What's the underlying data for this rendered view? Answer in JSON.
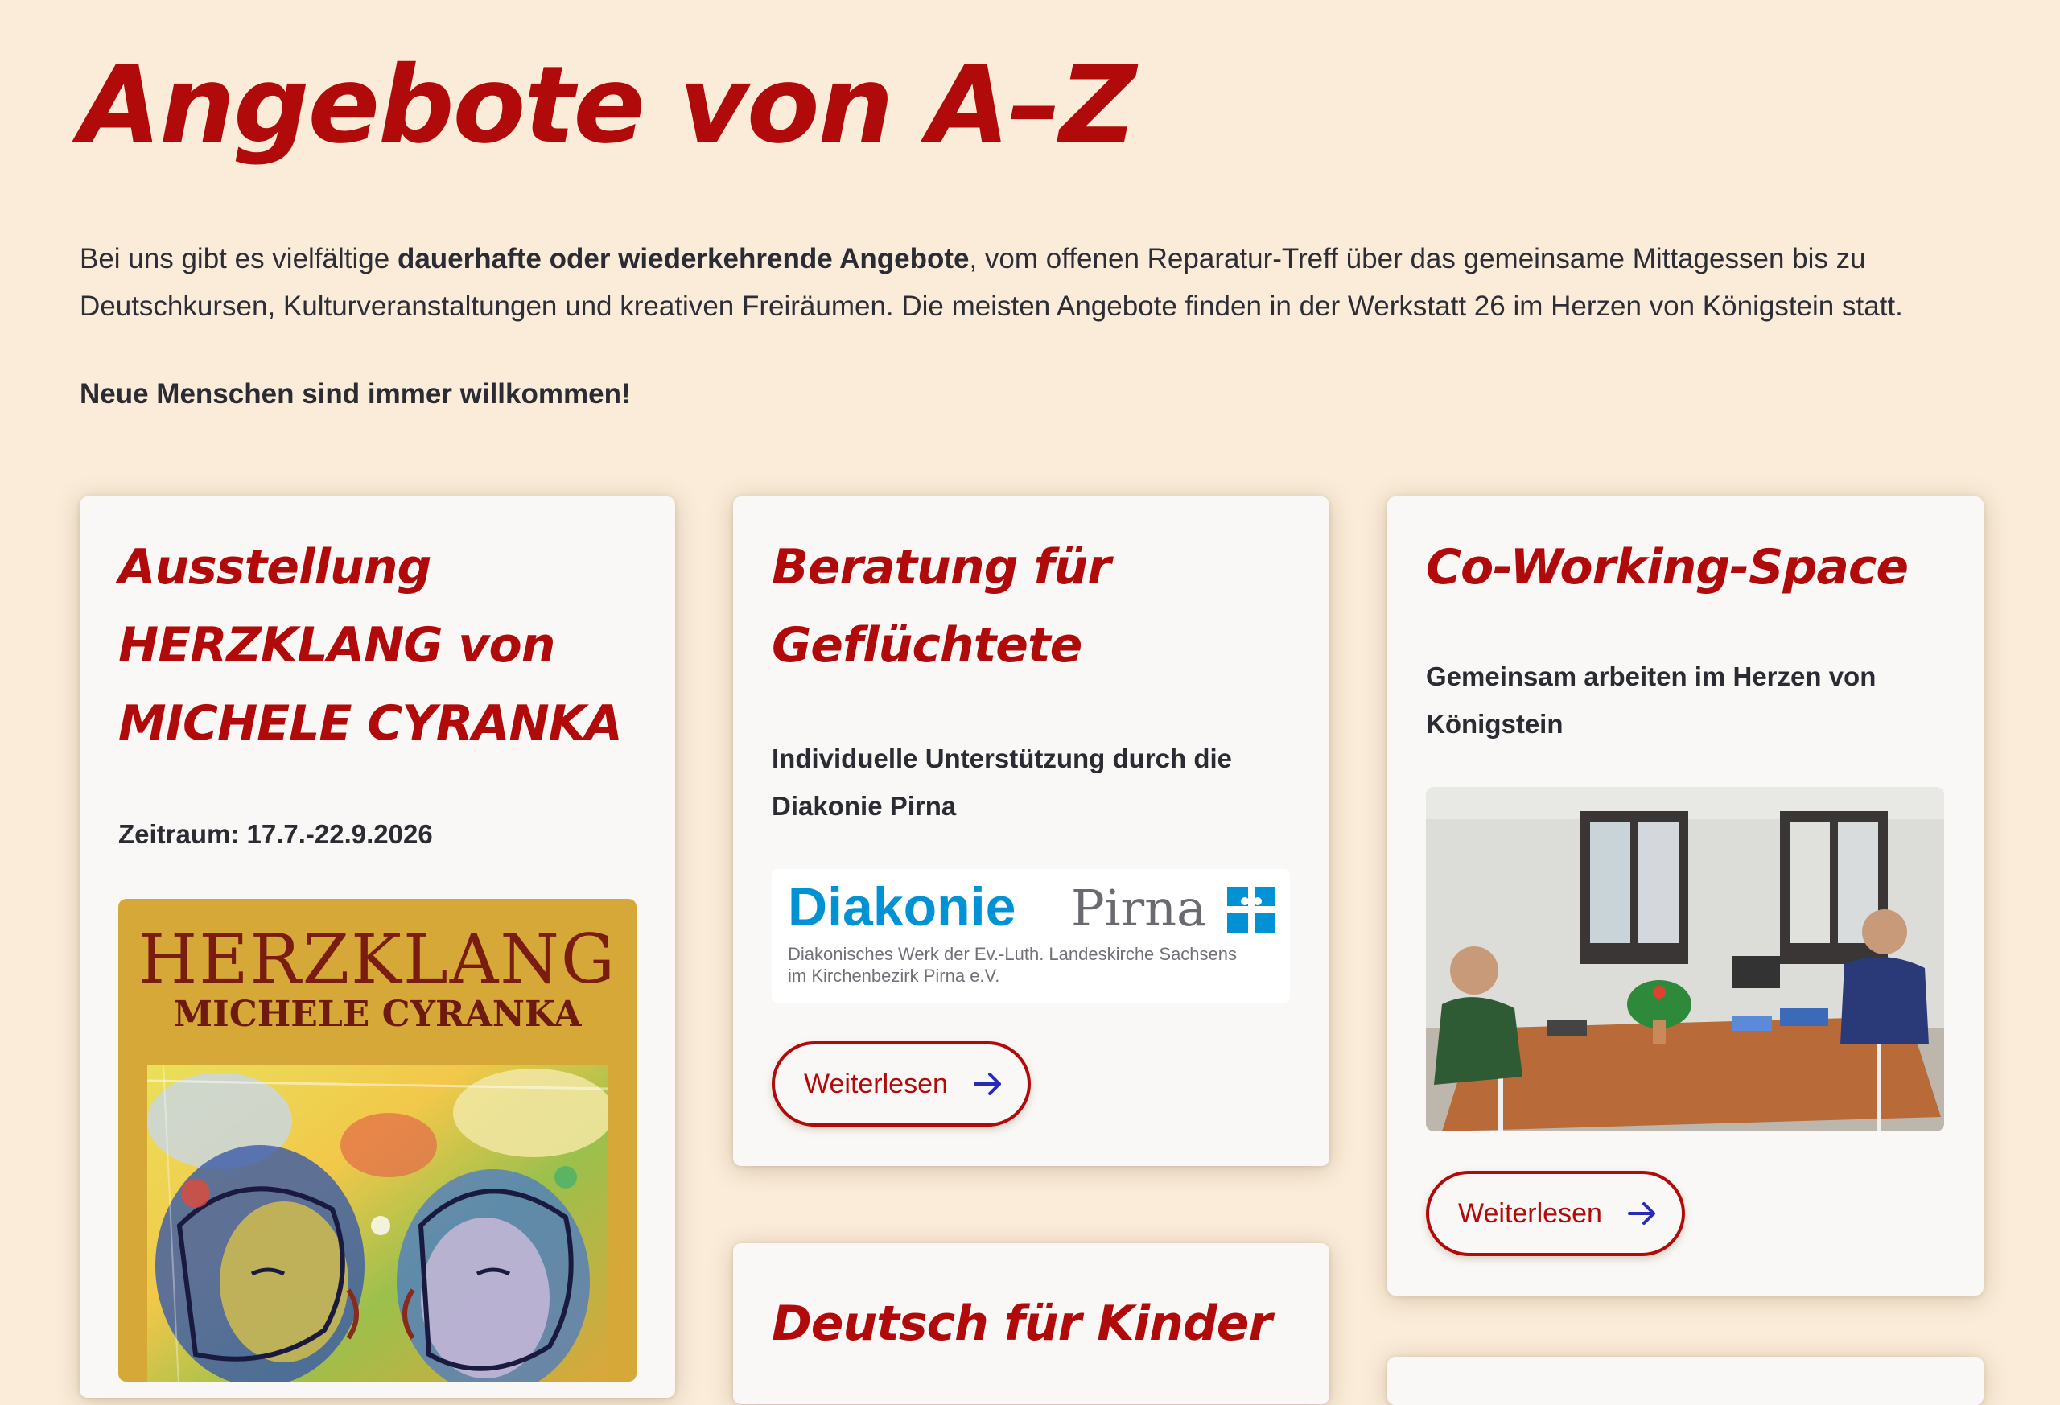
{
  "page": {
    "title": "Angebote von A–Z",
    "intro_part1": "Bei uns gibt es vielfältige ",
    "intro_bold": "dauerhafte oder wiederkehrende Angebote",
    "intro_part2": ", vom offenen Reparatur-Treff über das gemeinsame Mittagessen bis zu Deutschkursen, Kulturveranstaltungen und kreativen Freiräumen. Die meisten Angebote finden in der Werkstatt 26 im Herzen von Königstein statt.",
    "welcome": "Neue Menschen sind immer willkommen!"
  },
  "cards": [
    {
      "title": "Ausstellung HERZKLANG von MICHELE CYRANKA",
      "text": "Zeitraum: 17.7.-22.9.2026",
      "poster": {
        "title": "HERZKLANG",
        "subtitle": "MICHELE CYRANKA"
      }
    },
    {
      "title": "Beratung für Geflüchtete",
      "text": "Individuelle Unterstützung durch die Diakonie Pirna",
      "logo": {
        "word1": "Diakonie",
        "word2": "Pirna",
        "line1": "Diakonisches Werk der Ev.-Luth. Landeskirche Sachsens",
        "line2": "im Kirchenbezirk Pirna e.V."
      },
      "button": "Weiterlesen"
    },
    {
      "title": "Co-Working-Space",
      "text": "Gemeinsam arbeiten im Herzen von Königstein",
      "button": "Weiterlesen"
    },
    {
      "title": "Deutsch für Kinder"
    }
  ],
  "colors": {
    "background": "#faecd9",
    "accent": "#b00a0a",
    "card": "#faf8f6",
    "arrow": "#2a2ab8"
  },
  "icons": {
    "button_arrow": "arrow-right-icon"
  }
}
